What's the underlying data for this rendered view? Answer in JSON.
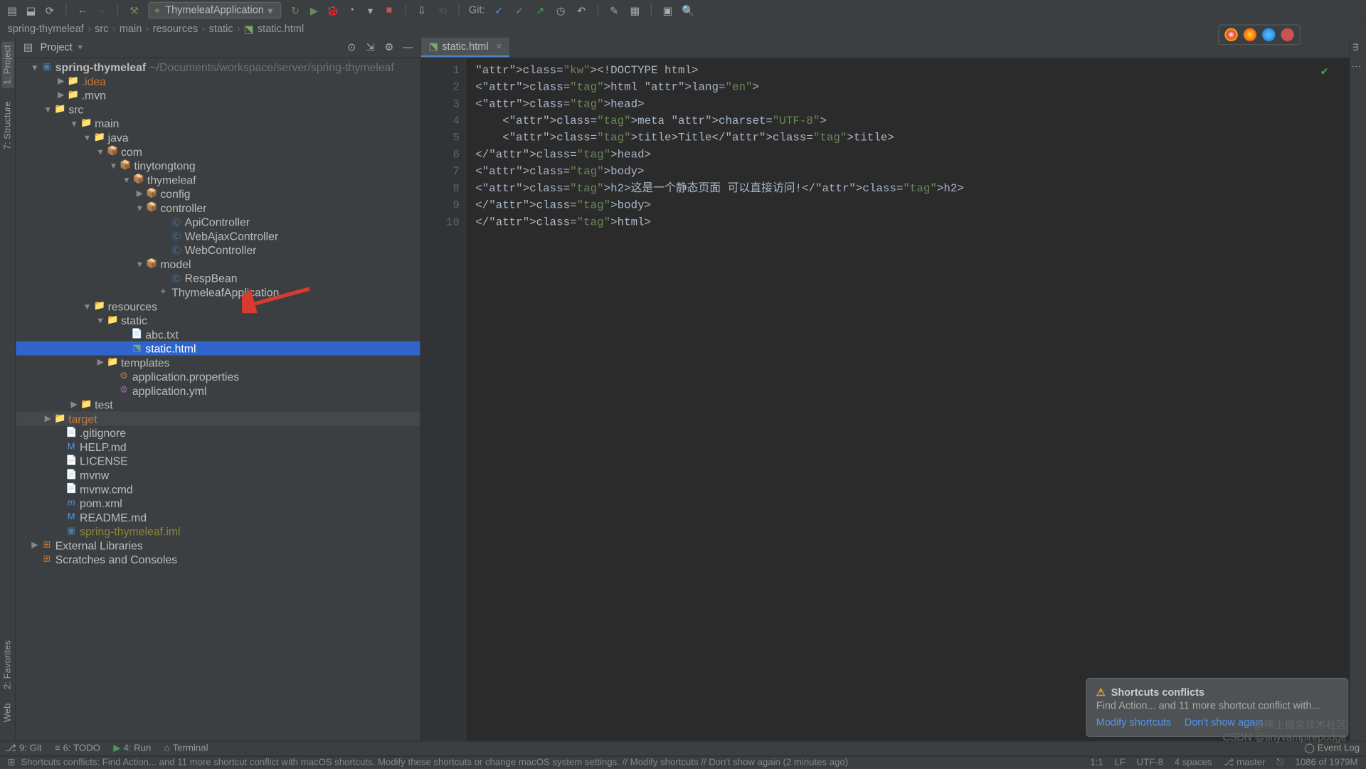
{
  "toolbar": {
    "runconfig": "ThymeleafApplication",
    "git_label": "Git:"
  },
  "breadcrumb": [
    "spring-thymeleaf",
    "src",
    "main",
    "resources",
    "static",
    "static.html"
  ],
  "project": {
    "title": "Project",
    "root_name": "spring-thymeleaf",
    "root_path": "~/Documents/workspace/server/spring-thymeleaf",
    "nodes": {
      "idea": ".idea",
      "mvn": ".mvn",
      "src": "src",
      "main": "main",
      "java": "java",
      "com": "com",
      "tiny": "tinytongtong",
      "thymeleaf": "thymeleaf",
      "config": "config",
      "controller": "controller",
      "api": "ApiController",
      "webajax": "WebAjaxController",
      "web": "WebController",
      "model": "model",
      "respbean": "RespBean",
      "app": "ThymeleafApplication",
      "resources": "resources",
      "static": "static",
      "abc": "abc.txt",
      "statichtml": "static.html",
      "templates": "templates",
      "appprops": "application.properties",
      "appyml": "application.yml",
      "test": "test",
      "target": "target",
      "gitignore": ".gitignore",
      "help": "HELP.md",
      "license": "LICENSE",
      "mvnw": "mvnw",
      "mvnwcmd": "mvnw.cmd",
      "pom": "pom.xml",
      "readme": "README.md",
      "iml": "spring-thymeleaf.iml",
      "extlib": "External Libraries",
      "scratch": "Scratches and Consoles"
    }
  },
  "tab": {
    "label": "static.html"
  },
  "code": {
    "lines": [
      "<!DOCTYPE html>",
      "<html lang=\"en\">",
      "<head>",
      "    <meta charset=\"UTF-8\">",
      "    <title>Title</title>",
      "</head>",
      "<body>",
      "<h2>这是一个静态页面 可以直接访问!</h2>",
      "</body>",
      "</html>"
    ]
  },
  "bottom": {
    "git": "9: Git",
    "todo": "6: TODO",
    "run": "4: Run",
    "terminal": "Terminal"
  },
  "status": {
    "msg": "Shortcuts conflicts: Find Action... and 11 more shortcut conflict with macOS shortcuts. Modify these shortcuts or change macOS system settings. // Modify shortcuts // Don't show again (2 minutes ago)",
    "pos": "1:1",
    "sep": "LF",
    "enc": "UTF-8",
    "indent": "4 spaces",
    "branch": "master",
    "lock": "⎋"
  },
  "notif": {
    "title": "Shortcuts conflicts",
    "body": "Find Action... and 11 more shortcut conflict with...",
    "link1": "Modify shortcuts",
    "link2": "Don't show again"
  },
  "leftgutter": {
    "project": "1: Project",
    "structure": "7: Structure",
    "fav": "2: Favorites",
    "web": "Web"
  },
  "watermark1": "@稀土掘金技术社区",
  "watermark2": "CSDN @tinyvampirepudge"
}
